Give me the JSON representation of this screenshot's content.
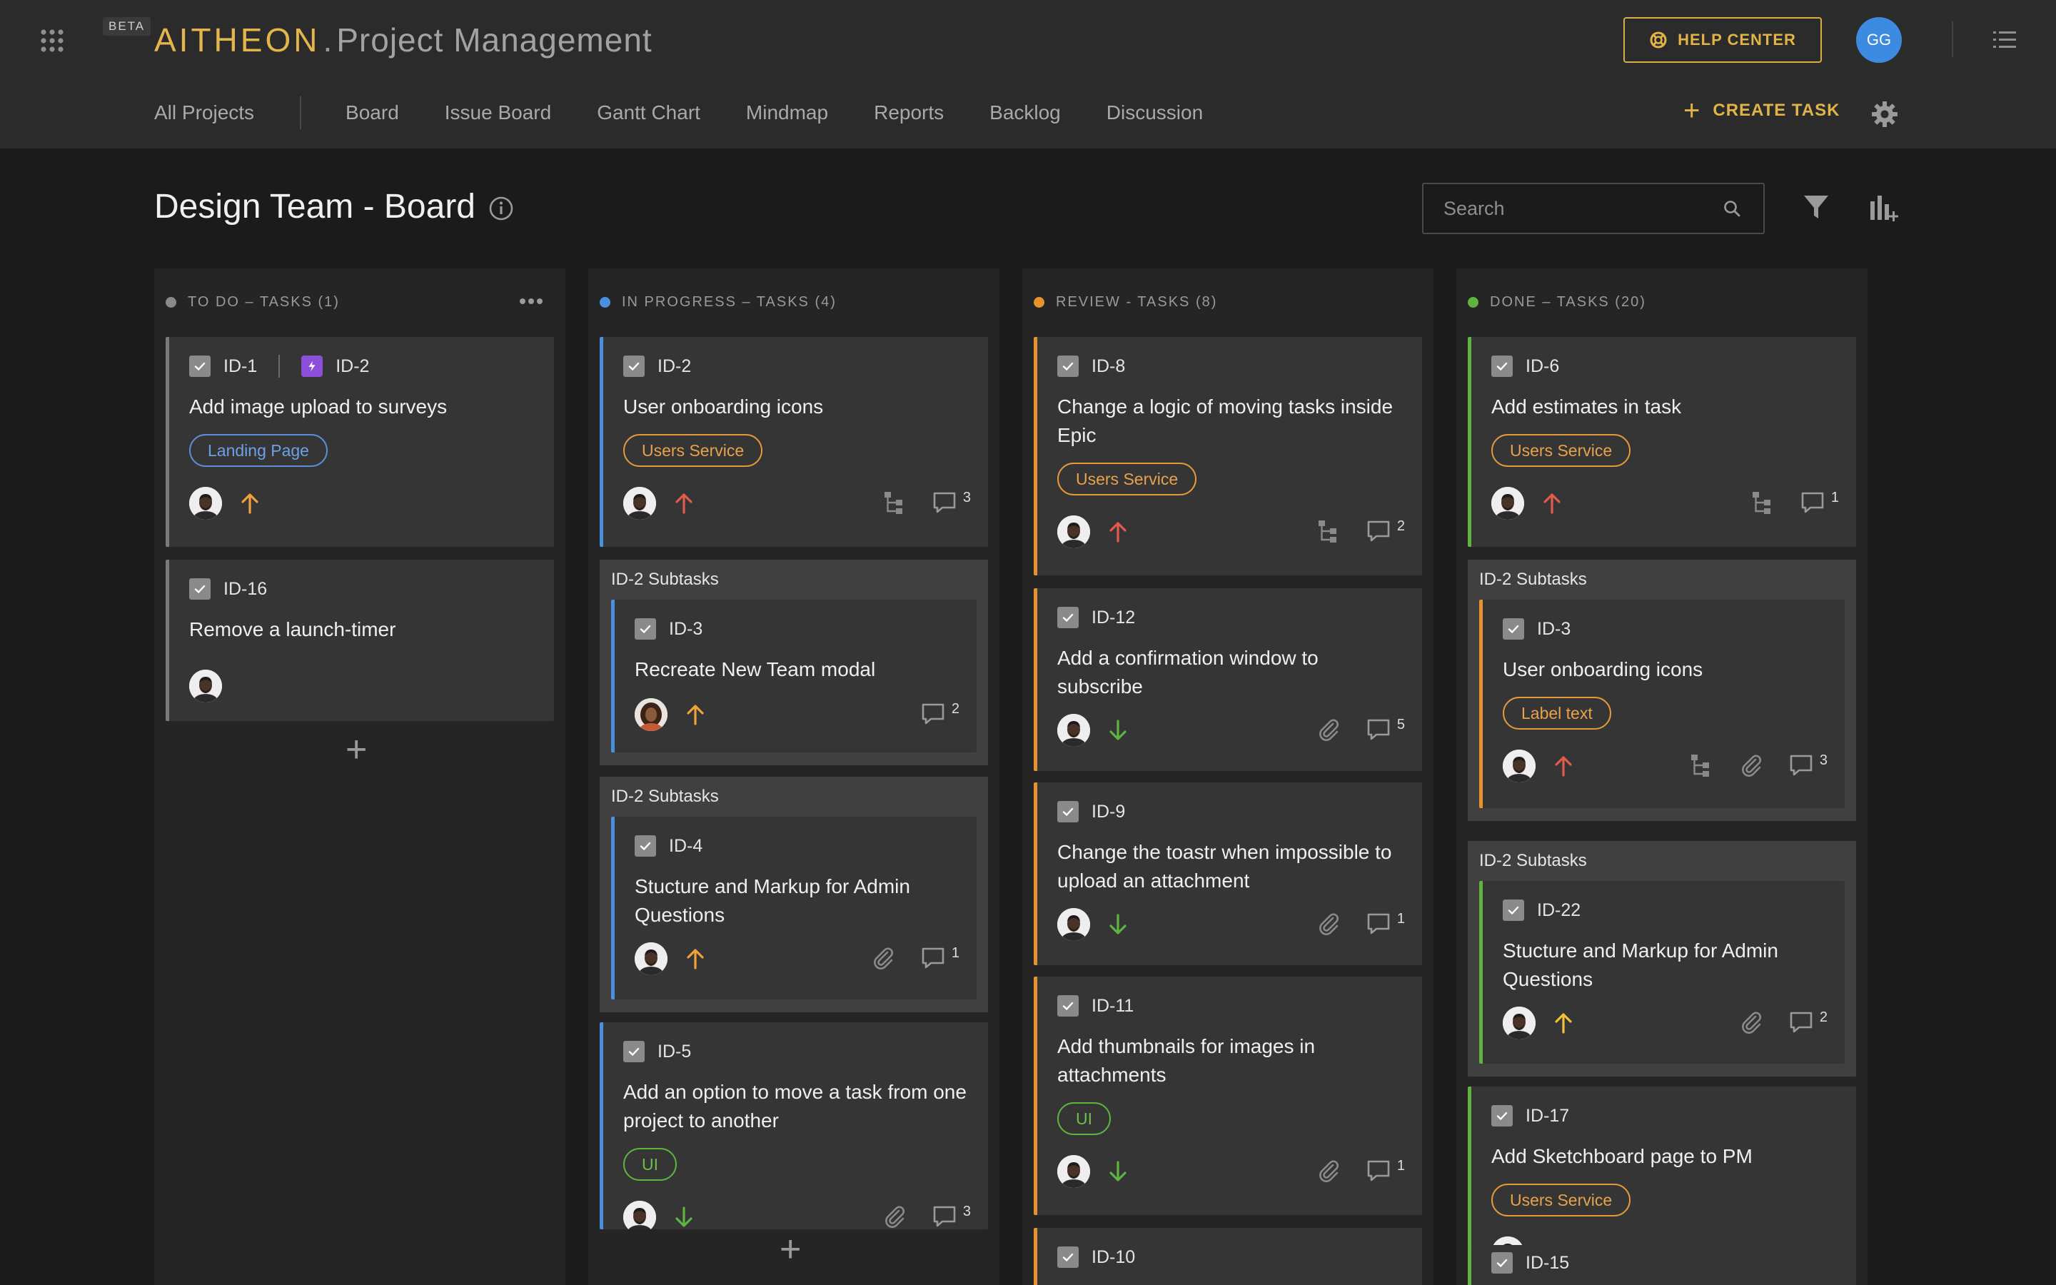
{
  "app": {
    "beta": "BETA",
    "logo": "AITHEON",
    "separator": ".",
    "title": "Project Management",
    "help_center": "HELP CENTER",
    "user_initials": "GG",
    "create_task": "CREATE TASK"
  },
  "colors": {
    "accent": "#e2b448",
    "todo": "#8a8a8a",
    "in_progress": "#4a8fe0",
    "review": "#e8922e",
    "done": "#5fb33f",
    "priority_high": "#e05a4e",
    "priority_medium": "#f0a23a",
    "priority_low": "#5fb33f"
  },
  "nav": {
    "all_projects": "All Projects",
    "tabs": [
      "Board",
      "Issue Board",
      "Gantt Chart",
      "Mindmap",
      "Reports",
      "Backlog",
      "Discussion"
    ]
  },
  "page": {
    "title": "Design Team - Board",
    "search_placeholder": "Search"
  },
  "columns": [
    {
      "title": "TO DO – TASKS (1)",
      "cards": [
        {
          "id": "ID-1",
          "epic": "ID-2",
          "title": "Add image upload to surveys",
          "tag": "Landing Page",
          "priority": "medium"
        },
        {
          "id": "ID-16",
          "title": "Remove a launch-timer"
        }
      ]
    },
    {
      "title": "IN PROGRESS – TASKS (4)",
      "cards": [
        {
          "id": "ID-2",
          "title": "User onboarding icons",
          "tag": "Users Service",
          "priority": "high",
          "comments": "3"
        },
        {
          "group": "ID-2 Subtasks",
          "id": "ID-3",
          "title": "Recreate New Team modal",
          "priority": "medium",
          "comments": "2"
        },
        {
          "group": "ID-2 Subtasks",
          "id": "ID-4",
          "title": "Stucture and Markup for Admin Questions",
          "priority": "medium",
          "comments": "1"
        },
        {
          "id": "ID-5",
          "title": "Add an option to move a task from one project to another",
          "tag": "UI",
          "priority": "low",
          "comments": "3"
        }
      ]
    },
    {
      "title": "REVIEW - TASKS (8)",
      "cards": [
        {
          "id": "ID-8",
          "title": "Change a logic of moving tasks inside Epic",
          "tag": "Users Service",
          "priority": "high",
          "comments": "2"
        },
        {
          "id": "ID-12",
          "title": "Add a confirmation window to subscribe",
          "priority": "low",
          "comments": "5"
        },
        {
          "id": "ID-9",
          "title": "Change the toastr when impossible to upload an attachment",
          "priority": "low",
          "comments": "1"
        },
        {
          "id": "ID-11",
          "title": "Add thumbnails for images in attachments",
          "tag": "UI",
          "priority": "low",
          "comments": "1"
        },
        {
          "id": "ID-10"
        }
      ]
    },
    {
      "title": "DONE – TASKS (20)",
      "cards": [
        {
          "id": "ID-6",
          "title": "Add estimates in task",
          "tag": "Users Service",
          "priority": "high",
          "comments": "1"
        },
        {
          "group": "ID-2 Subtasks",
          "id": "ID-3",
          "title": "User onboarding icons",
          "tag": "Label text",
          "priority": "high",
          "comments": "3"
        },
        {
          "group": "ID-2 Subtasks",
          "id": "ID-22",
          "title": "Stucture and Markup for Admin Questions",
          "priority": "medium",
          "comments": "2"
        },
        {
          "id": "ID-17",
          "title": "Add Sketchboard page to PM",
          "tag": "Users Service"
        },
        {
          "id": "ID-15"
        }
      ]
    }
  ],
  "icons": [
    "apps-grid-icon",
    "help-lifebuoy-icon",
    "list-menu-icon",
    "plus-icon",
    "gear-icon",
    "info-icon",
    "search-icon",
    "filter-icon",
    "chart-add-icon",
    "more-icon",
    "checkbox-icon",
    "epic-bolt-icon",
    "priority-arrow-icon",
    "subtask-tree-icon",
    "attachment-icon",
    "comment-icon"
  ]
}
